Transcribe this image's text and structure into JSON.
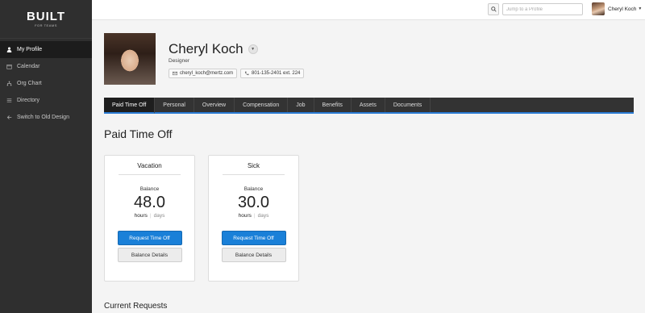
{
  "sidebar": {
    "logo": {
      "main": "BUILT",
      "sub": "FOR TEAMS"
    },
    "items": [
      {
        "label": "My Profile",
        "icon": "user-icon",
        "active": true
      },
      {
        "label": "Calendar",
        "icon": "calendar-icon",
        "active": false
      },
      {
        "label": "Org Chart",
        "icon": "org-chart-icon",
        "active": false
      },
      {
        "label": "Directory",
        "icon": "list-icon",
        "active": false
      },
      {
        "label": "Switch to Old Design",
        "icon": "arrow-left-icon",
        "active": false
      }
    ]
  },
  "topbar": {
    "search_placeholder": "Jump to a Profile",
    "user_name": "Cheryl Koch"
  },
  "profile": {
    "name": "Cheryl Koch",
    "title": "Designer",
    "email": "cheryl_koch@mertz.com",
    "phone": "801-135-2401 ext. 224"
  },
  "tabs": [
    "Paid Time Off",
    "Personal",
    "Overview",
    "Compensation",
    "Job",
    "Benefits",
    "Assets",
    "Documents"
  ],
  "main": {
    "section_title": "Paid Time Off",
    "cards": [
      {
        "title": "Vacation",
        "balance_label": "Balance",
        "value": "48.0",
        "unit_hours": "hours",
        "unit_days": "days",
        "request_label": "Request Time Off",
        "details_label": "Balance Details"
      },
      {
        "title": "Sick",
        "balance_label": "Balance",
        "value": "30.0",
        "unit_hours": "hours",
        "unit_days": "days",
        "request_label": "Request Time Off",
        "details_label": "Balance Details"
      }
    ],
    "current_requests_title": "Current Requests"
  },
  "colors": {
    "accent": "#1a80d8",
    "sidebar": "#2f2f2f",
    "tab_bar": "#333333"
  }
}
